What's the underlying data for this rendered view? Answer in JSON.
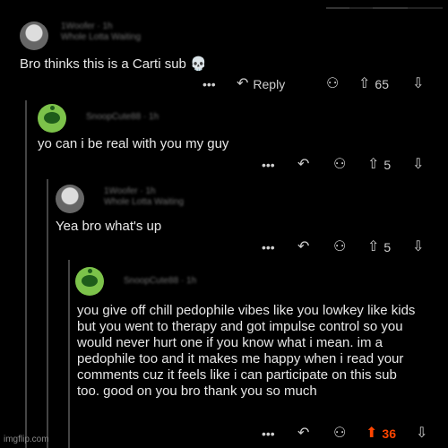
{
  "comments": [
    {
      "meta": "1Woofer · 1h\nWhole Lotta Waiting",
      "text": "Bro thinks this is a Carti sub 💀",
      "more": "•••",
      "reply_icon": "reply-arrow",
      "reply_label": "Reply",
      "award_icon": "award",
      "vote_icon": "upvote-arrow",
      "votes": "65",
      "down_icon": "downvote-arrow"
    },
    {
      "meta": "SnoopCute88 · 1h",
      "text": "yo can i be real with you my guy",
      "more": "•••",
      "votes": "5"
    },
    {
      "meta": "1Woofer · 1h\nWhole Lotta Waiting",
      "text": "Yea bro what's up",
      "more": "•••",
      "votes": "5"
    },
    {
      "meta": "SnoopCute88 · 1h",
      "text": "you give off chill pedophile vibes like you lowkey like kids but you went to therapy and got impulse control so you would never hurt one if you know what i mean. im a pedophile too and it makes me happy when i read your comments cuz it feels like i can participate on this sub too. good on you bro thank you so much",
      "more": "•••",
      "votes": "36",
      "upvoted": true
    }
  ],
  "watermark": "imgflip.com",
  "colors": {
    "accent": "#ff4500",
    "background": "#000000",
    "snoo": "#7cc24a"
  }
}
